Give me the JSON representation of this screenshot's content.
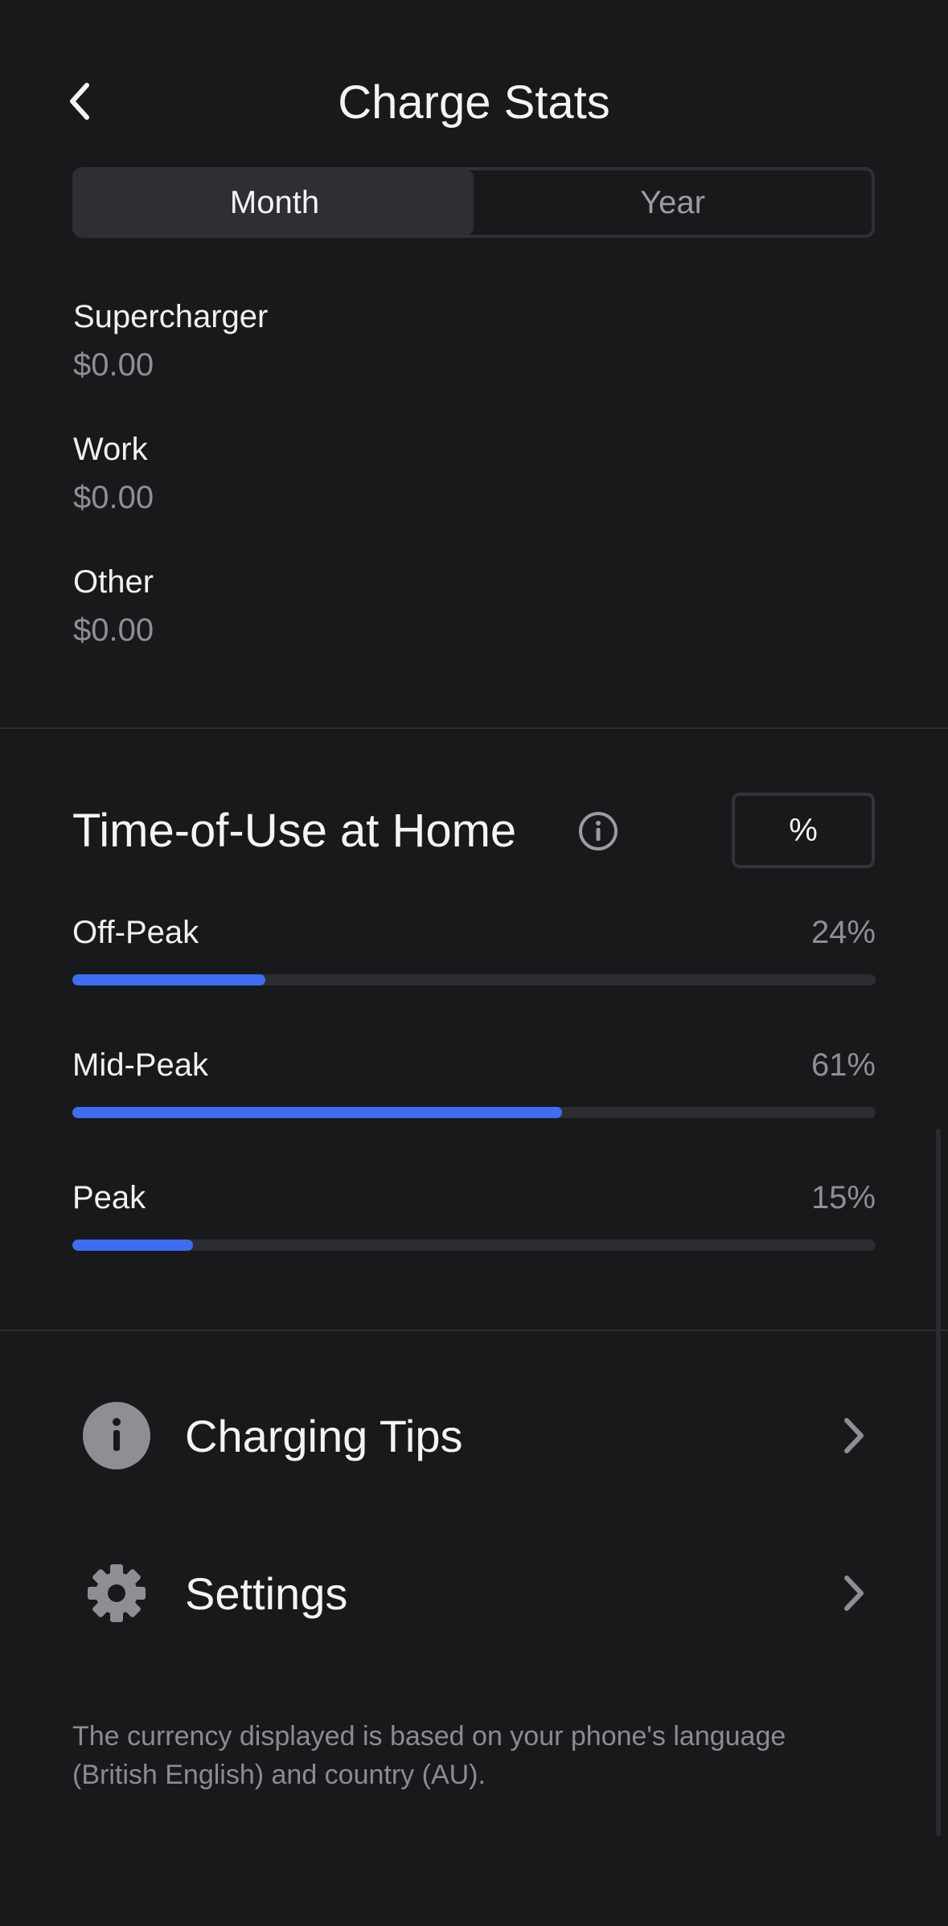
{
  "header": {
    "title": "Charge Stats"
  },
  "period_toggle": {
    "options": [
      "Month",
      "Year"
    ],
    "selected": "Month"
  },
  "locations": [
    {
      "name": "Supercharger",
      "value": "$0.00"
    },
    {
      "name": "Work",
      "value": "$0.00"
    },
    {
      "name": "Other",
      "value": "$0.00"
    }
  ],
  "time_of_use": {
    "title": "Time-of-Use at Home",
    "unit_toggle": "%",
    "rows": [
      {
        "label": "Off-Peak",
        "percent_label": "24%",
        "fraction": 0.24
      },
      {
        "label": "Mid-Peak",
        "percent_label": "61%",
        "fraction": 0.61
      },
      {
        "label": "Peak",
        "percent_label": "15%",
        "fraction": 0.15
      }
    ]
  },
  "menu": {
    "charging_tips": "Charging Tips",
    "settings": "Settings"
  },
  "footnote": "The currency displayed is based on your phone's language (British English) and country (AU).",
  "colors": {
    "background": "#18191b",
    "accent_bar": "#3e6df2",
    "track": "#2c2d30"
  }
}
